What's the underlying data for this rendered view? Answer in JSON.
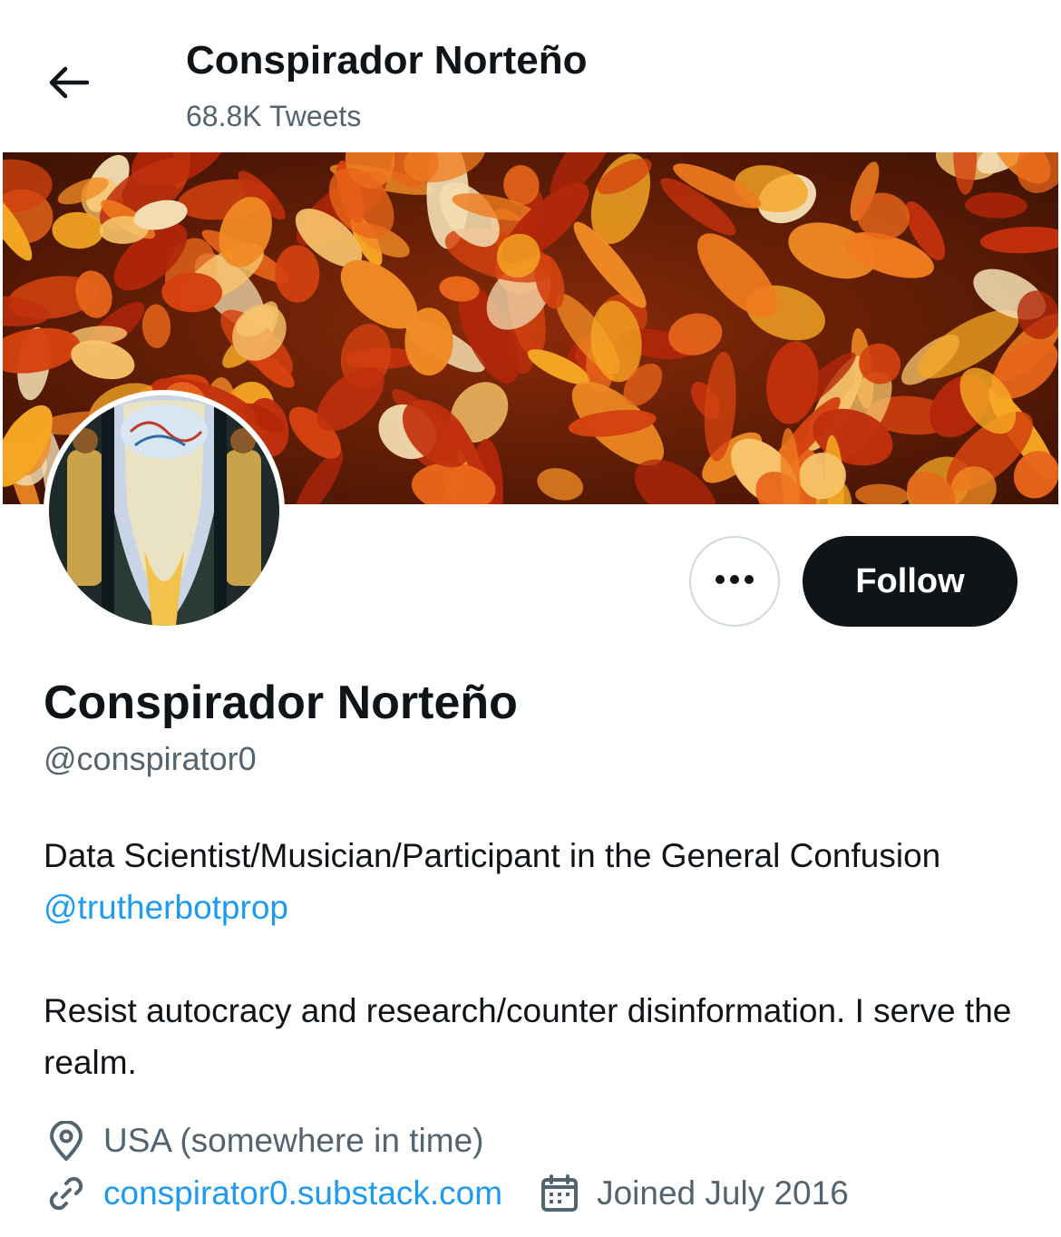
{
  "header": {
    "back_icon": "arrow-left-icon",
    "name": "Conspirador Norteño",
    "tweet_count": "68.8K Tweets"
  },
  "banner": {
    "description_icon": "autumn-leaves-banner"
  },
  "avatar": {
    "icon": "mural-avatar"
  },
  "actions": {
    "more_icon": "more-dots-icon",
    "follow_label": "Follow"
  },
  "profile": {
    "name": "Conspirador Norteño",
    "handle": "@conspirator0",
    "bio_line1": "Data Scientist/Musician/Participant in the General Confusion ",
    "bio_mention": "@trutherbotprop",
    "bio_line2": "Resist autocracy and research/counter disinformation. I serve the realm.",
    "location": "USA (somewhere in time)",
    "website": "conspirator0.substack.com",
    "joined": "Joined July 2016"
  },
  "colors": {
    "text": "#0f1419",
    "secondary": "#536471",
    "link": "#1d9bf0",
    "button": "#0f1419"
  }
}
